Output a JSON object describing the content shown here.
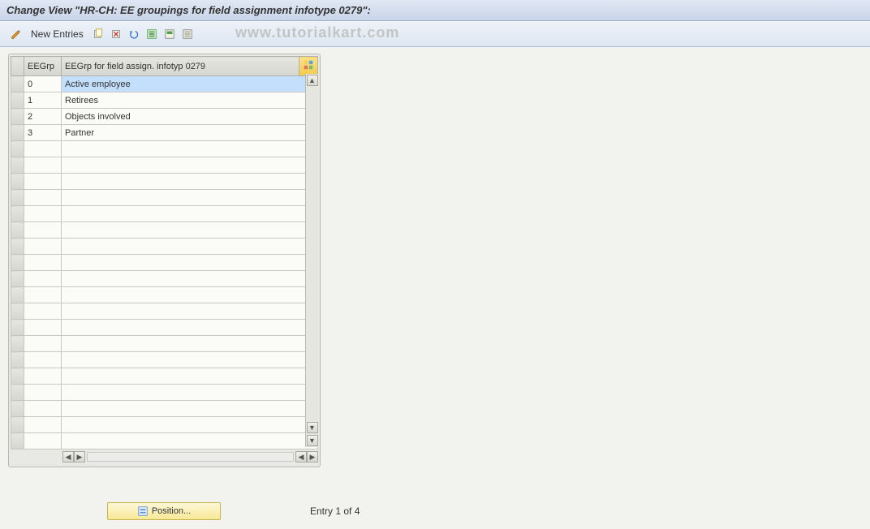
{
  "title": "Change View \"HR-CH: EE groupings for field assignment infotype 0279\":",
  "toolbar": {
    "new_entries": "New Entries"
  },
  "watermark": "www.tutorialkart.com",
  "table": {
    "col_id": "EEGrp",
    "col_desc": "EEGrp for field assign. infotyp 0279",
    "rows": [
      {
        "id": "0",
        "desc": "Active employee",
        "selected": true
      },
      {
        "id": "1",
        "desc": "Retirees",
        "selected": false
      },
      {
        "id": "2",
        "desc": "Objects involved",
        "selected": false
      },
      {
        "id": "3",
        "desc": "Partner",
        "selected": false
      }
    ],
    "empty_rows": 19
  },
  "footer": {
    "position_btn": "Position...",
    "entry_text": "Entry 1 of 4"
  }
}
